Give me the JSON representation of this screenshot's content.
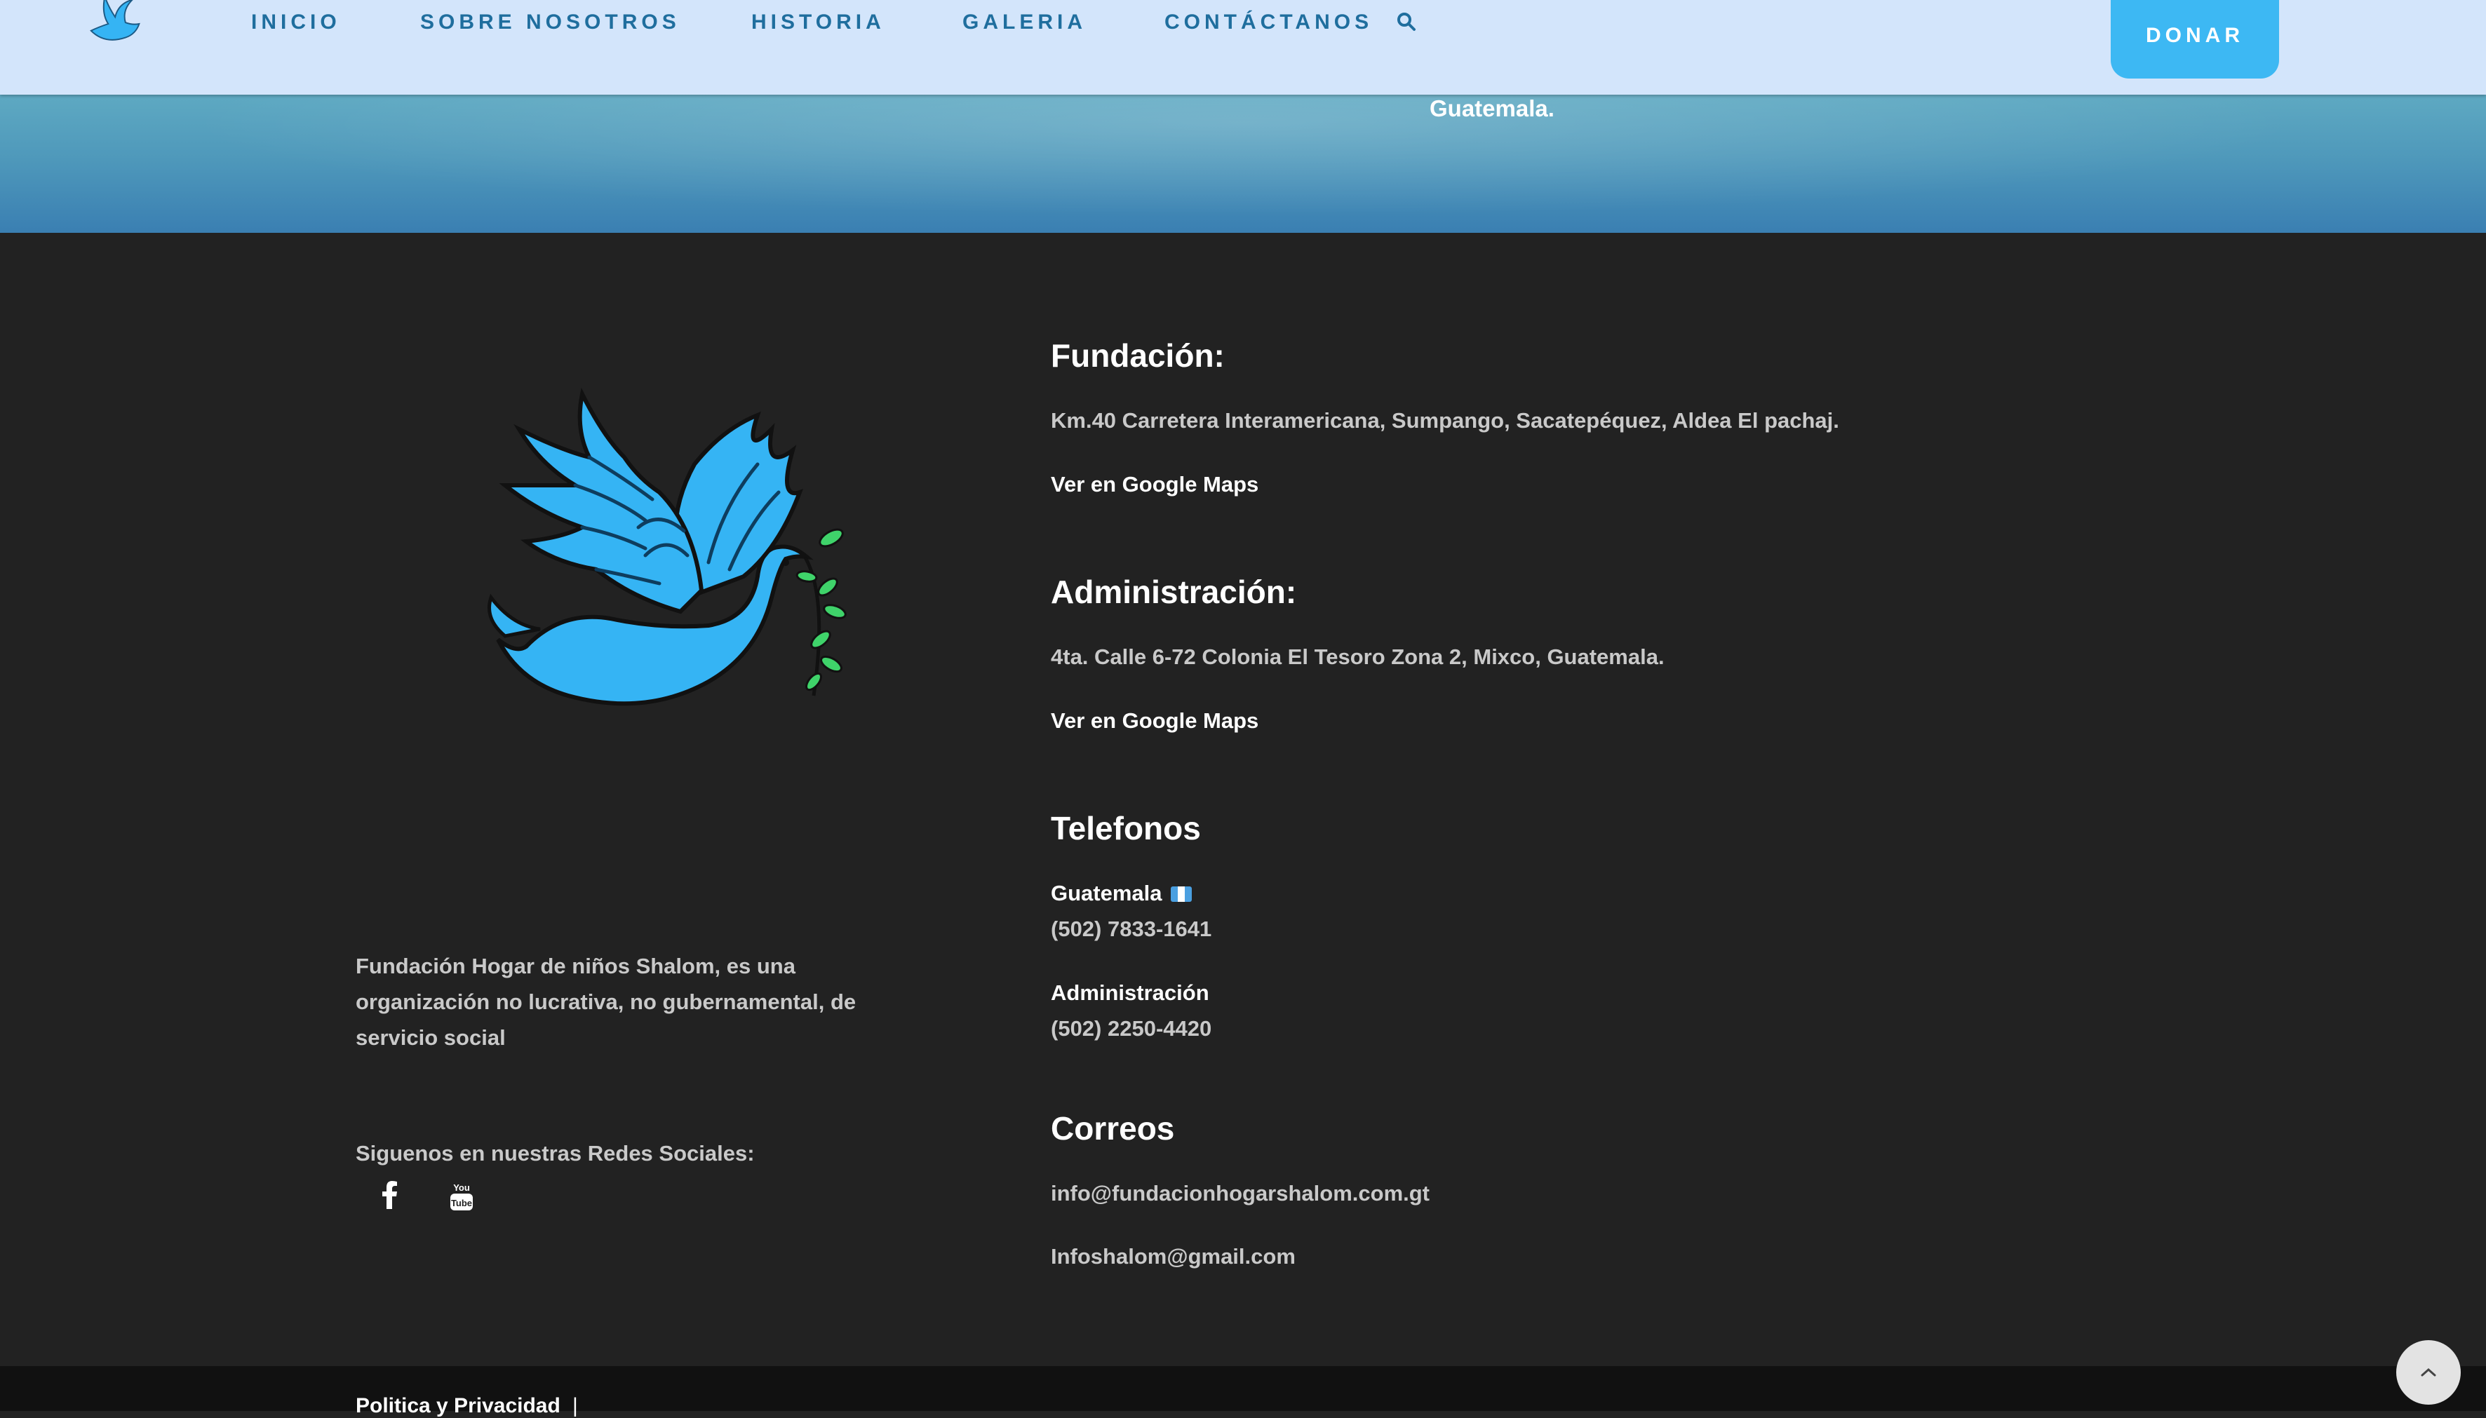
{
  "header": {
    "nav": [
      {
        "label": "INICIO"
      },
      {
        "label": "SOBRE NOSOTROS"
      },
      {
        "label": "HISTORIA"
      },
      {
        "label": "GALERIA"
      },
      {
        "label": "CONTÁCTANOS"
      }
    ],
    "donate_label": "DONAR",
    "icons": {
      "logo": "dove-logo-icon",
      "search": "search-icon"
    }
  },
  "hero": {
    "text": "Guatemala."
  },
  "footer": {
    "about_text": "Fundación Hogar de niños Shalom, es una organización no lucrativa, no gubernamental, de servicio social",
    "social_title": "Siguenos en nuestras Redes Sociales:",
    "social_icons": [
      "facebook-icon",
      "youtube-icon"
    ],
    "fundacion": {
      "title": "Fundación:",
      "address": "Km.40 Carretera Interamericana, Sumpango, Sacatepéquez, Aldea El pachaj.",
      "maps_link": "Ver en Google Maps"
    },
    "administracion": {
      "title": "Administración:",
      "address": "4ta. Calle 6-72 Colonia El Tesoro Zona 2, Mixco, Guatemala.",
      "maps_link": "Ver en Google Maps"
    },
    "telefonos": {
      "title": "Telefonos",
      "entries": [
        {
          "label": "Guatemala",
          "number": "(502) 7833-1641"
        },
        {
          "label": "Administración",
          "number": "(502) 2250-4420"
        }
      ]
    },
    "correos": {
      "title": "Correos",
      "emails": [
        "info@fundacionhogarshalom.com.gt",
        "Infoshalom@gmail.com"
      ]
    }
  },
  "bottom_bar": {
    "policy_link": "Politica y Privacidad",
    "separator": "|"
  },
  "colors": {
    "header_bg": "#d3e5fb",
    "nav_text": "#1f6e9e",
    "donate_bg": "#3db8f3",
    "footer_bg": "#222222",
    "dove_blue": "#35b4f4",
    "olive_green": "#3fd36a"
  }
}
